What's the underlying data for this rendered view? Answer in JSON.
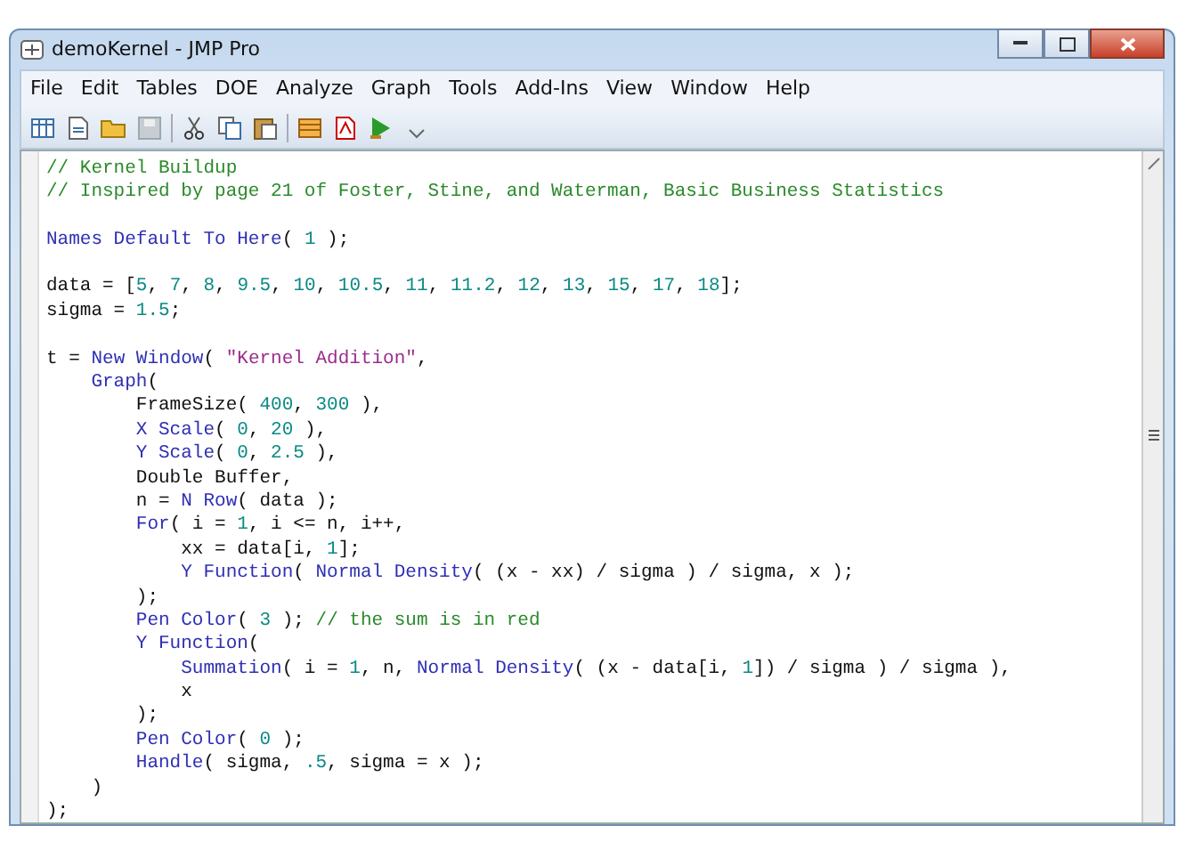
{
  "window": {
    "title": "demoKernel - JMP Pro"
  },
  "menu": [
    "File",
    "Edit",
    "Tables",
    "DOE",
    "Analyze",
    "Graph",
    "Tools",
    "Add-Ins",
    "View",
    "Window",
    "Help"
  ],
  "editor": {
    "lines": [
      {
        "kind": "code",
        "tokens": [
          {
            "kind": "comment",
            "text": "// Kernel Buildup"
          }
        ]
      },
      {
        "kind": "code",
        "tokens": [
          {
            "kind": "comment",
            "text": "// Inspired by page 21 of Foster, Stine, and Waterman, Basic Business Statistics"
          }
        ]
      },
      {
        "kind": "blank"
      },
      {
        "kind": "code",
        "tokens": [
          {
            "kind": "keyword",
            "text": "Names Default To Here"
          },
          {
            "kind": "plain",
            "text": "( "
          },
          {
            "kind": "number",
            "text": "1"
          },
          {
            "kind": "plain",
            "text": " );"
          }
        ]
      },
      {
        "kind": "blank"
      },
      {
        "kind": "code",
        "tokens": [
          {
            "kind": "plain",
            "text": "data = ["
          },
          {
            "kind": "number",
            "text": "5"
          },
          {
            "kind": "plain",
            "text": ", "
          },
          {
            "kind": "number",
            "text": "7"
          },
          {
            "kind": "plain",
            "text": ", "
          },
          {
            "kind": "number",
            "text": "8"
          },
          {
            "kind": "plain",
            "text": ", "
          },
          {
            "kind": "number",
            "text": "9.5"
          },
          {
            "kind": "plain",
            "text": ", "
          },
          {
            "kind": "number",
            "text": "10"
          },
          {
            "kind": "plain",
            "text": ", "
          },
          {
            "kind": "number",
            "text": "10.5"
          },
          {
            "kind": "plain",
            "text": ", "
          },
          {
            "kind": "number",
            "text": "11"
          },
          {
            "kind": "plain",
            "text": ", "
          },
          {
            "kind": "number",
            "text": "11.2"
          },
          {
            "kind": "plain",
            "text": ", "
          },
          {
            "kind": "number",
            "text": "12"
          },
          {
            "kind": "plain",
            "text": ", "
          },
          {
            "kind": "number",
            "text": "13"
          },
          {
            "kind": "plain",
            "text": ", "
          },
          {
            "kind": "number",
            "text": "15"
          },
          {
            "kind": "plain",
            "text": ", "
          },
          {
            "kind": "number",
            "text": "17"
          },
          {
            "kind": "plain",
            "text": ", "
          },
          {
            "kind": "number",
            "text": "18"
          },
          {
            "kind": "plain",
            "text": "];"
          }
        ]
      },
      {
        "kind": "code",
        "tokens": [
          {
            "kind": "plain",
            "text": "sigma = "
          },
          {
            "kind": "number",
            "text": "1.5"
          },
          {
            "kind": "plain",
            "text": ";"
          }
        ]
      },
      {
        "kind": "blank"
      },
      {
        "kind": "code",
        "tokens": [
          {
            "kind": "plain",
            "text": "t = "
          },
          {
            "kind": "keyword",
            "text": "New Window"
          },
          {
            "kind": "plain",
            "text": "( "
          },
          {
            "kind": "string",
            "text": "\"Kernel Addition\""
          },
          {
            "kind": "plain",
            "text": ","
          }
        ]
      },
      {
        "kind": "code",
        "tokens": [
          {
            "kind": "keyword",
            "text": "    Graph"
          },
          {
            "kind": "plain",
            "text": "("
          }
        ]
      },
      {
        "kind": "code",
        "tokens": [
          {
            "kind": "plain",
            "text": "        FrameSize( "
          },
          {
            "kind": "number",
            "text": "400"
          },
          {
            "kind": "plain",
            "text": ", "
          },
          {
            "kind": "number",
            "text": "300"
          },
          {
            "kind": "plain",
            "text": " ),"
          }
        ]
      },
      {
        "kind": "code",
        "tokens": [
          {
            "kind": "keyword",
            "text": "        X Scale"
          },
          {
            "kind": "plain",
            "text": "( "
          },
          {
            "kind": "number",
            "text": "0"
          },
          {
            "kind": "plain",
            "text": ", "
          },
          {
            "kind": "number",
            "text": "20"
          },
          {
            "kind": "plain",
            "text": " ),"
          }
        ]
      },
      {
        "kind": "code",
        "tokens": [
          {
            "kind": "keyword",
            "text": "        Y Scale"
          },
          {
            "kind": "plain",
            "text": "( "
          },
          {
            "kind": "number",
            "text": "0"
          },
          {
            "kind": "plain",
            "text": ", "
          },
          {
            "kind": "number",
            "text": "2.5"
          },
          {
            "kind": "plain",
            "text": " ),"
          }
        ]
      },
      {
        "kind": "code",
        "tokens": [
          {
            "kind": "plain",
            "text": "        Double Buffer,"
          }
        ]
      },
      {
        "kind": "code",
        "tokens": [
          {
            "kind": "plain",
            "text": "        n = "
          },
          {
            "kind": "keyword",
            "text": "N Row"
          },
          {
            "kind": "plain",
            "text": "( data );"
          }
        ]
      },
      {
        "kind": "code",
        "tokens": [
          {
            "kind": "keyword",
            "text": "        For"
          },
          {
            "kind": "plain",
            "text": "( i = "
          },
          {
            "kind": "number",
            "text": "1"
          },
          {
            "kind": "plain",
            "text": ", i <= n, i++,"
          }
        ]
      },
      {
        "kind": "code",
        "tokens": [
          {
            "kind": "plain",
            "text": "            xx = data[i, "
          },
          {
            "kind": "number",
            "text": "1"
          },
          {
            "kind": "plain",
            "text": "];"
          }
        ]
      },
      {
        "kind": "code",
        "tokens": [
          {
            "kind": "keyword",
            "text": "            Y Function"
          },
          {
            "kind": "plain",
            "text": "( "
          },
          {
            "kind": "keyword",
            "text": "Normal Density"
          },
          {
            "kind": "plain",
            "text": "( (x - xx) / sigma ) / sigma, x );"
          }
        ]
      },
      {
        "kind": "code",
        "tokens": [
          {
            "kind": "plain",
            "text": "        );"
          }
        ]
      },
      {
        "kind": "code",
        "tokens": [
          {
            "kind": "keyword",
            "text": "        Pen Color"
          },
          {
            "kind": "plain",
            "text": "( "
          },
          {
            "kind": "number",
            "text": "3"
          },
          {
            "kind": "plain",
            "text": " ); "
          },
          {
            "kind": "comment",
            "text": "// the sum is in red"
          }
        ]
      },
      {
        "kind": "code",
        "tokens": [
          {
            "kind": "keyword",
            "text": "        Y Function"
          },
          {
            "kind": "plain",
            "text": "("
          }
        ]
      },
      {
        "kind": "code",
        "tokens": [
          {
            "kind": "keyword",
            "text": "            Summation"
          },
          {
            "kind": "plain",
            "text": "( i = "
          },
          {
            "kind": "number",
            "text": "1"
          },
          {
            "kind": "plain",
            "text": ", n, "
          },
          {
            "kind": "keyword",
            "text": "Normal Density"
          },
          {
            "kind": "plain",
            "text": "( (x - data[i, "
          },
          {
            "kind": "number",
            "text": "1"
          },
          {
            "kind": "plain",
            "text": "]) / sigma ) / sigma ),"
          }
        ]
      },
      {
        "kind": "code",
        "tokens": [
          {
            "kind": "plain",
            "text": "            x"
          }
        ]
      },
      {
        "kind": "code",
        "tokens": [
          {
            "kind": "plain",
            "text": "        );"
          }
        ]
      },
      {
        "kind": "code",
        "tokens": [
          {
            "kind": "keyword",
            "text": "        Pen Color"
          },
          {
            "kind": "plain",
            "text": "( "
          },
          {
            "kind": "number",
            "text": "0"
          },
          {
            "kind": "plain",
            "text": " );"
          }
        ]
      },
      {
        "kind": "code",
        "tokens": [
          {
            "kind": "keyword",
            "text": "        Handle"
          },
          {
            "kind": "plain",
            "text": "( sigma, "
          },
          {
            "kind": "number",
            "text": ".5"
          },
          {
            "kind": "plain",
            "text": ", sigma = x );"
          }
        ]
      },
      {
        "kind": "code",
        "tokens": [
          {
            "kind": "plain",
            "text": "    )"
          }
        ]
      },
      {
        "kind": "code",
        "tokens": [
          {
            "kind": "plain",
            "text": ");"
          }
        ]
      }
    ]
  }
}
